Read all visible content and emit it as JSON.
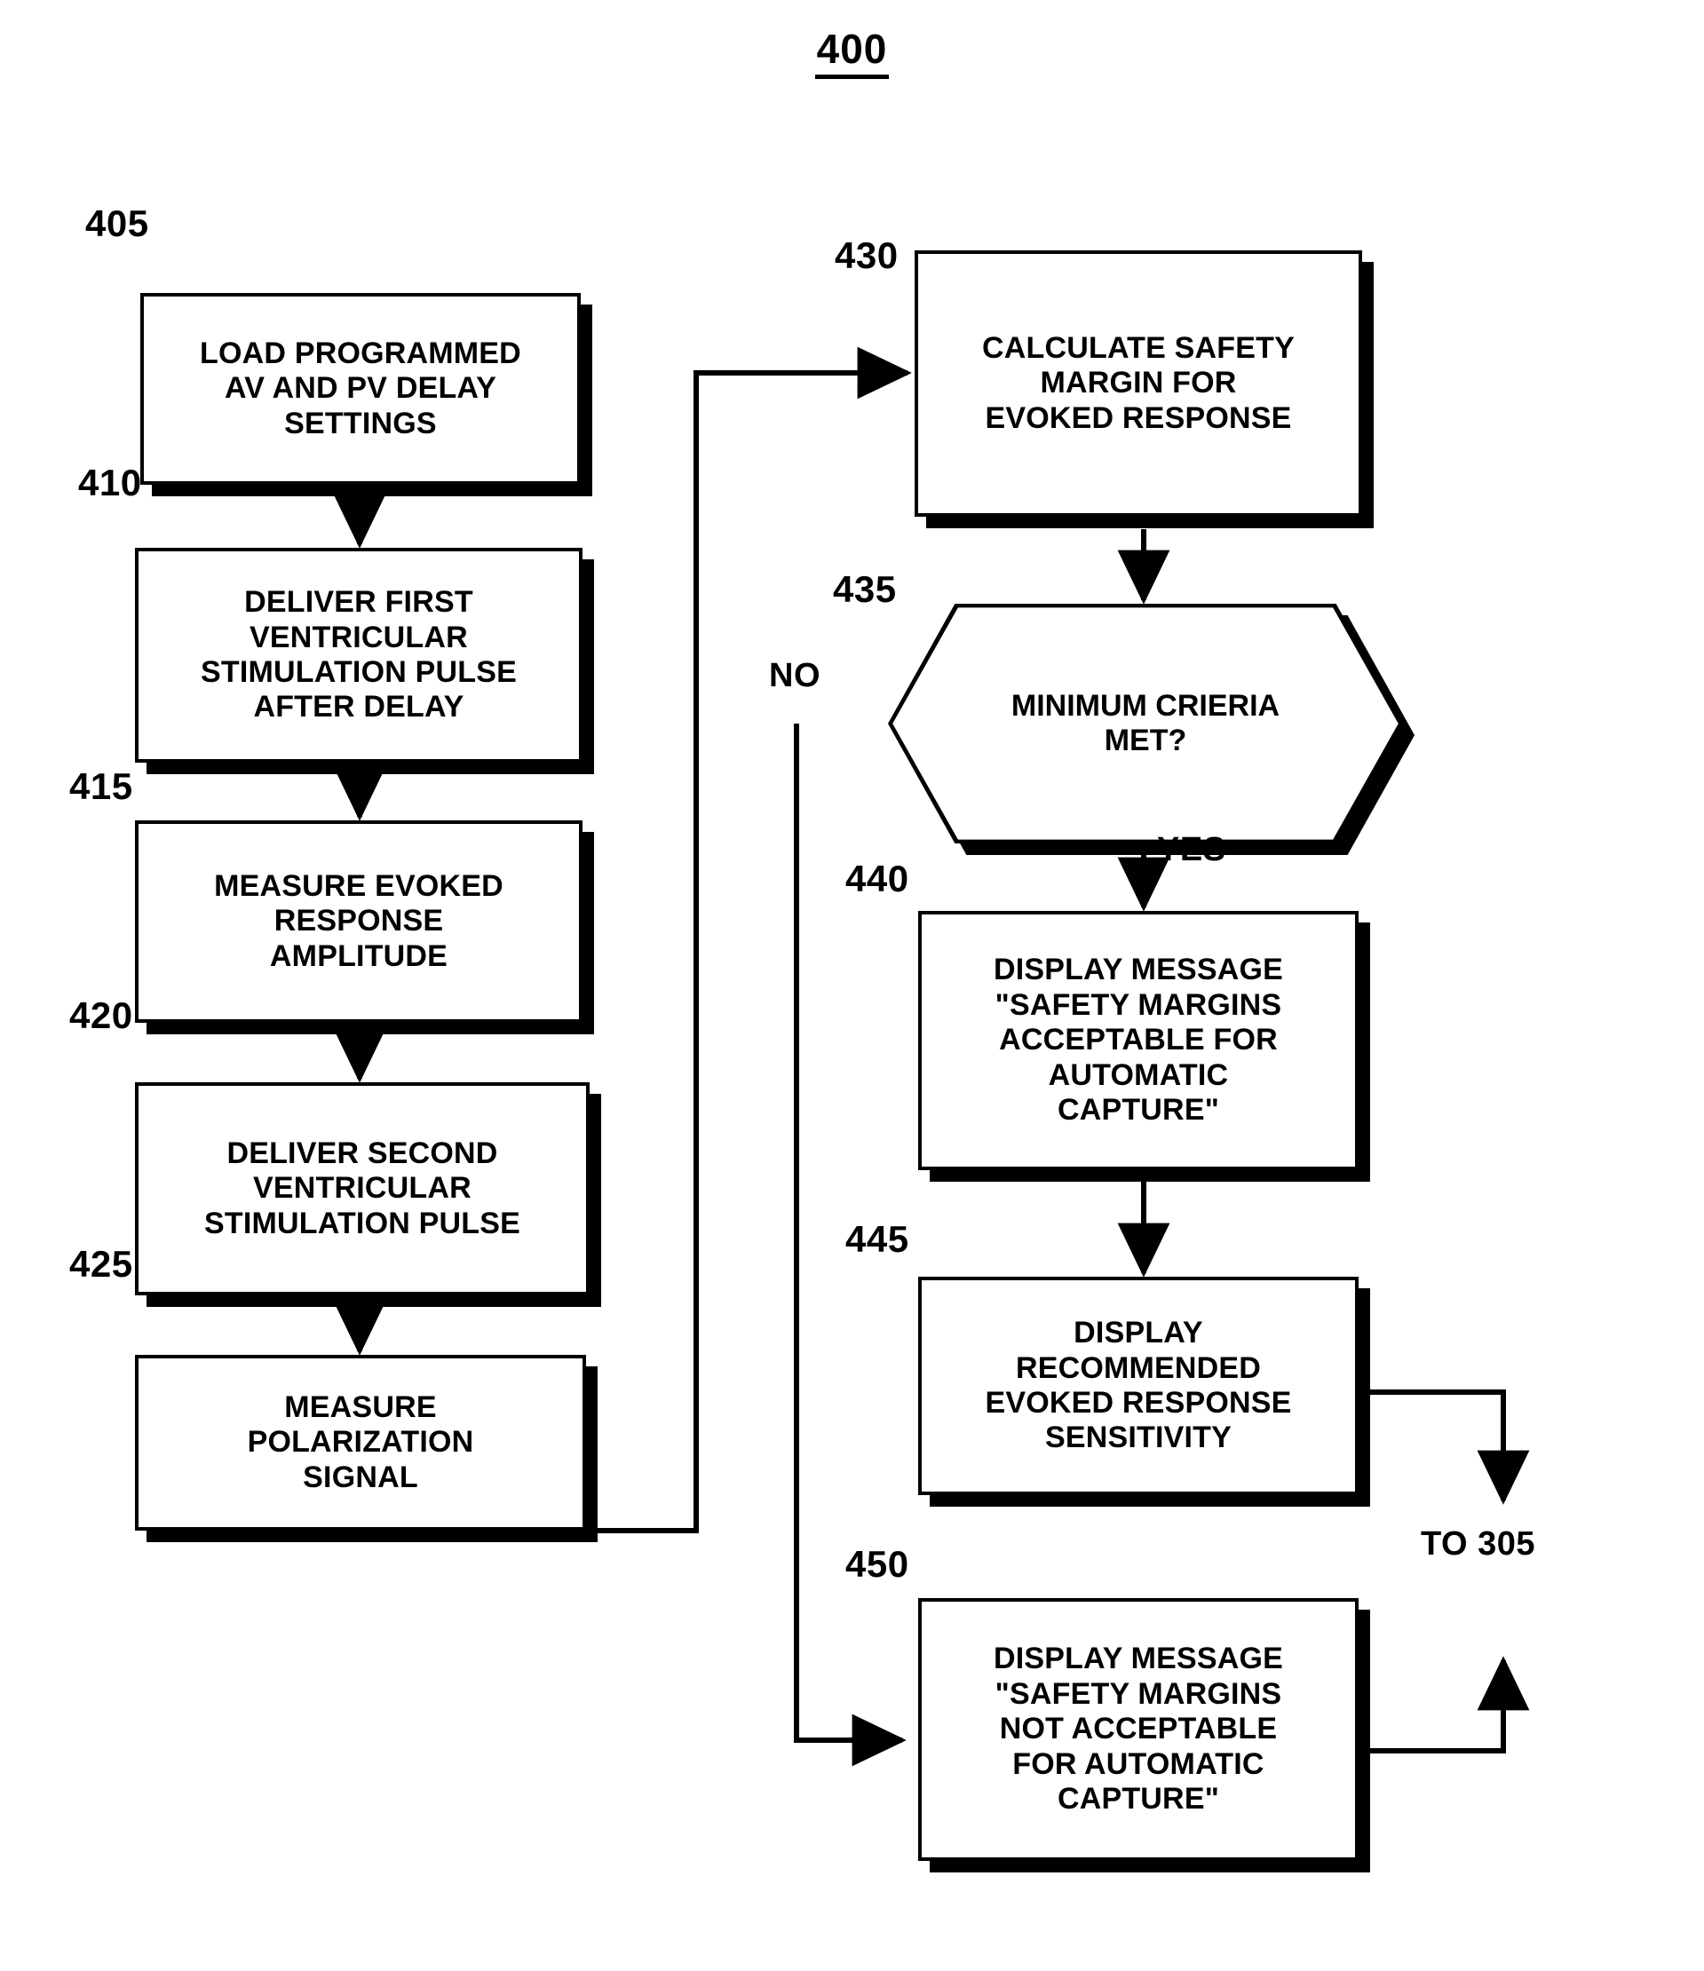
{
  "figure": {
    "number": "400"
  },
  "nodes": [
    {
      "ref": "405",
      "shape": "process",
      "text": "LOAD PROGRAMMED\nAV AND PV DELAY\nSETTINGS"
    },
    {
      "ref": "410",
      "shape": "process",
      "text": "DELIVER FIRST\nVENTRICULAR\nSTIMULATION PULSE\nAFTER DELAY"
    },
    {
      "ref": "415",
      "shape": "process",
      "text": "MEASURE EVOKED\nRESPONSE\nAMPLITUDE"
    },
    {
      "ref": "420",
      "shape": "process",
      "text": "DELIVER SECOND\nVENTRICULAR\nSTIMULATION PULSE"
    },
    {
      "ref": "425",
      "shape": "process",
      "text": "MEASURE\nPOLARIZATION\nSIGNAL"
    },
    {
      "ref": "430",
      "shape": "process",
      "text": "CALCULATE SAFETY\nMARGIN FOR\nEVOKED RESPONSE"
    },
    {
      "ref": "435",
      "shape": "decision",
      "text": "MINIMUM CRIERIA\nMET?"
    },
    {
      "ref": "440",
      "shape": "process",
      "text": "DISPLAY MESSAGE\n\"SAFETY MARGINS\nACCEPTABLE FOR\nAUTOMATIC\nCAPTURE\""
    },
    {
      "ref": "445",
      "shape": "process",
      "text": "DISPLAY\nRECOMMENDED\nEVOKED RESPONSE\nSENSITIVITY"
    },
    {
      "ref": "450",
      "shape": "process",
      "text": "DISPLAY MESSAGE\n\"SAFETY MARGINS\nNOT ACCEPTABLE\nFOR AUTOMATIC\nCAPTURE\""
    }
  ],
  "edge_labels": {
    "no": "NO",
    "yes": "YES",
    "to_305": "TO 305"
  },
  "colors": {
    "ink": "#000000",
    "paper": "#ffffff"
  }
}
